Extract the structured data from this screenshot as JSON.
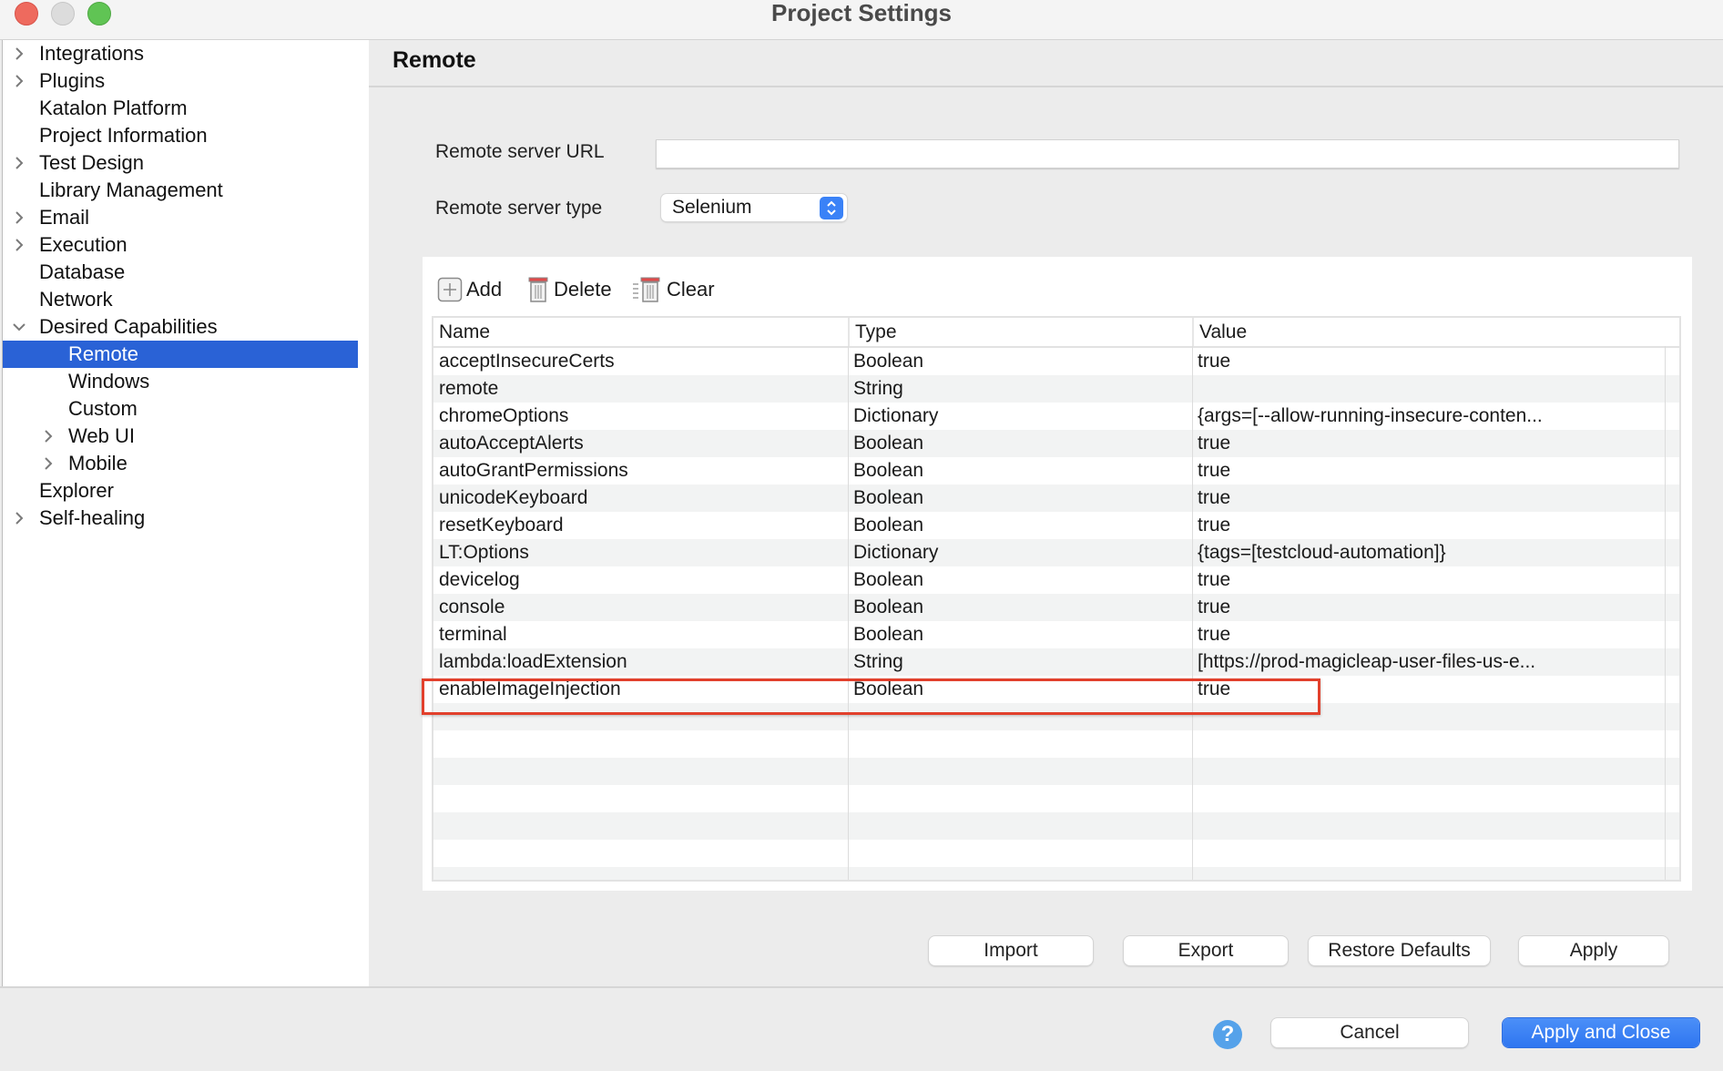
{
  "window": {
    "title": "Project Settings"
  },
  "sidebar": {
    "items": [
      {
        "label": "Integrations",
        "level": 0,
        "expander": "collapsed"
      },
      {
        "label": "Plugins",
        "level": 0,
        "expander": "collapsed"
      },
      {
        "label": "Katalon Platform",
        "level": 0,
        "expander": "none"
      },
      {
        "label": "Project Information",
        "level": 0,
        "expander": "none"
      },
      {
        "label": "Test Design",
        "level": 0,
        "expander": "collapsed"
      },
      {
        "label": "Library Management",
        "level": 0,
        "expander": "none"
      },
      {
        "label": "Email",
        "level": 0,
        "expander": "collapsed"
      },
      {
        "label": "Execution",
        "level": 0,
        "expander": "collapsed"
      },
      {
        "label": "Database",
        "level": 0,
        "expander": "none"
      },
      {
        "label": "Network",
        "level": 0,
        "expander": "none"
      },
      {
        "label": "Desired Capabilities",
        "level": 0,
        "expander": "expanded"
      },
      {
        "label": "Remote",
        "level": 1,
        "expander": "none",
        "selected": true
      },
      {
        "label": "Windows",
        "level": 1,
        "expander": "none"
      },
      {
        "label": "Custom",
        "level": 1,
        "expander": "none"
      },
      {
        "label": "Web UI",
        "level": 1,
        "expander": "collapsed"
      },
      {
        "label": "Mobile",
        "level": 1,
        "expander": "collapsed"
      },
      {
        "label": "Explorer",
        "level": 0,
        "expander": "none"
      },
      {
        "label": "Self-healing",
        "level": 0,
        "expander": "collapsed"
      }
    ]
  },
  "page": {
    "title": "Remote",
    "url_label": "Remote server URL",
    "url_value": "",
    "type_label": "Remote server type",
    "type_value": "Selenium"
  },
  "toolbar": {
    "add": "Add",
    "delete": "Delete",
    "clear": "Clear"
  },
  "table": {
    "columns": [
      "Name",
      "Type",
      "Value"
    ],
    "rows": [
      [
        "acceptInsecureCerts",
        "Boolean",
        "true"
      ],
      [
        "remote",
        "String",
        ""
      ],
      [
        "chromeOptions",
        "Dictionary",
        "{args=[--allow-running-insecure-conten..."
      ],
      [
        "autoAcceptAlerts",
        "Boolean",
        "true"
      ],
      [
        "autoGrantPermissions",
        "Boolean",
        "true"
      ],
      [
        "unicodeKeyboard",
        "Boolean",
        "true"
      ],
      [
        "resetKeyboard",
        "Boolean",
        "true"
      ],
      [
        "LT:Options",
        "Dictionary",
        "{tags=[testcloud-automation]}"
      ],
      [
        "devicelog",
        "Boolean",
        "true"
      ],
      [
        "console",
        "Boolean",
        "true"
      ],
      [
        "terminal",
        "Boolean",
        "true"
      ],
      [
        "lambda:loadExtension",
        "String",
        "[https://prod-magicleap-user-files-us-e..."
      ],
      [
        "enableImageInjection",
        "Boolean",
        "true"
      ]
    ],
    "empty_rows": 7,
    "highlighted_row": 12
  },
  "buttons": {
    "import": "Import",
    "export": "Export",
    "restore_defaults": "Restore Defaults",
    "apply": "Apply",
    "cancel": "Cancel",
    "apply_and_close": "Apply and Close",
    "help": "?"
  },
  "colors": {
    "selection": "#2a62d6",
    "primary": "#3a82f7",
    "highlight_border": "#e2402c"
  }
}
